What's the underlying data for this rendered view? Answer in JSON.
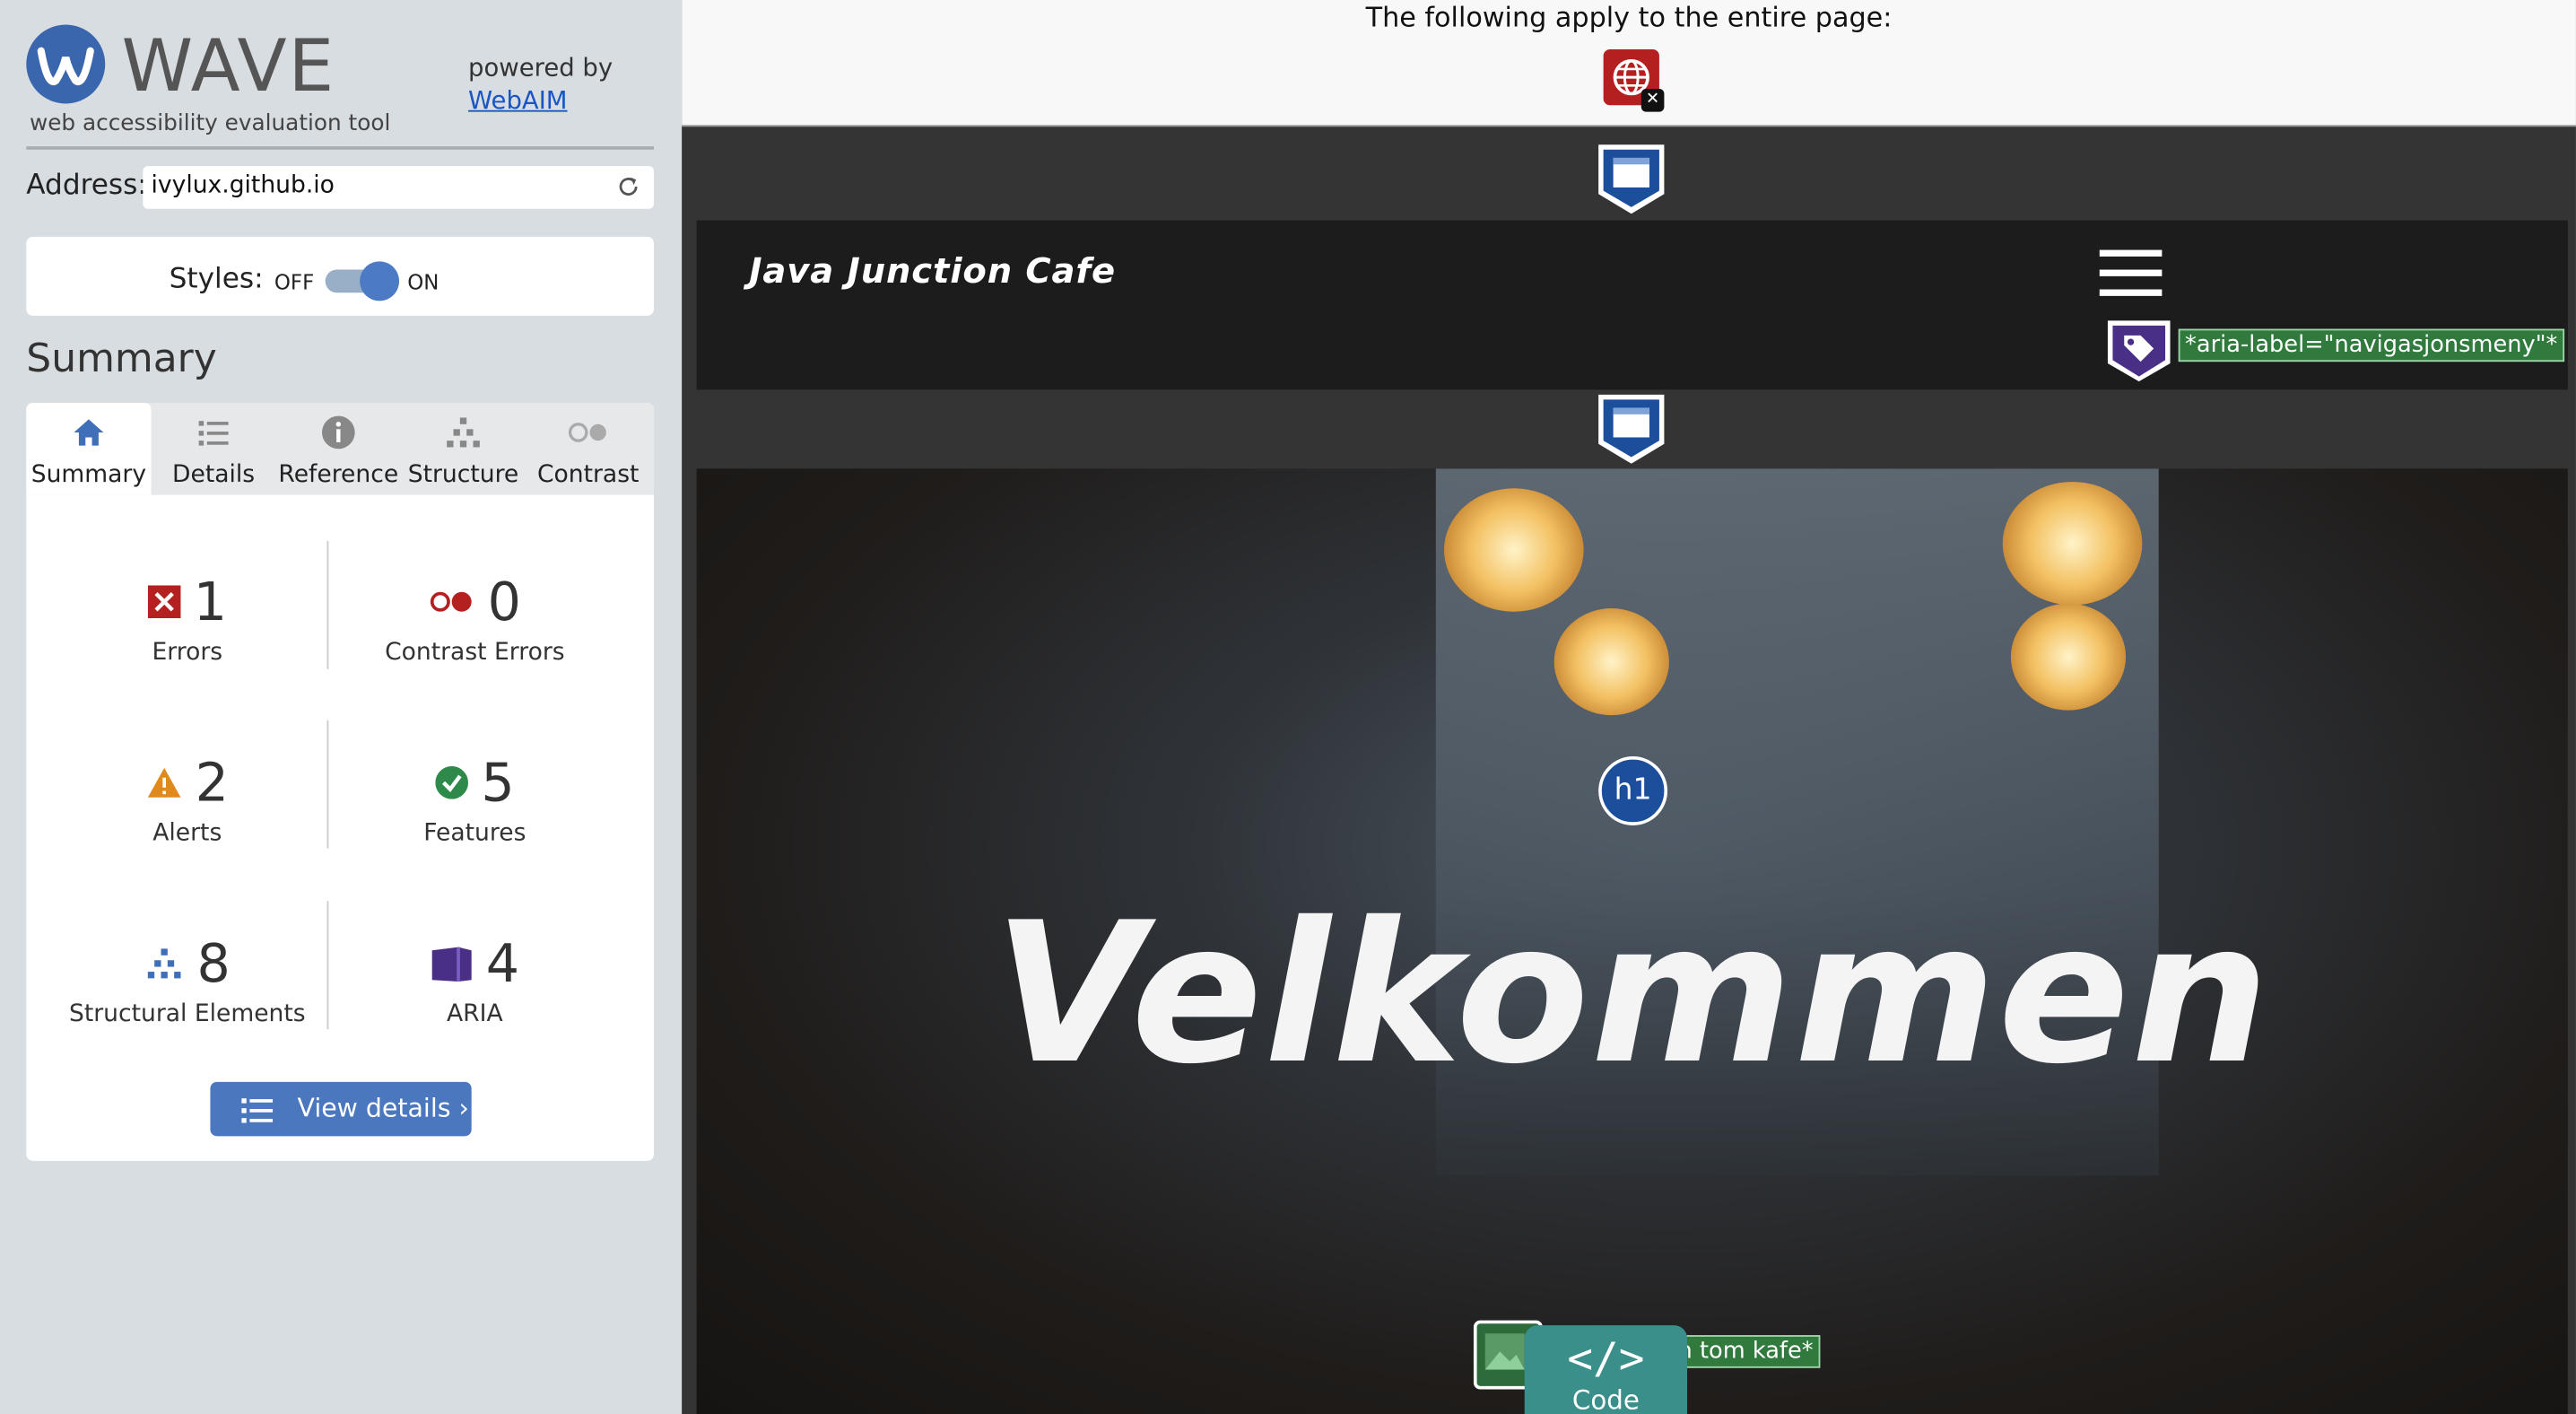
{
  "app": {
    "name": "WAVE",
    "tagline": "web accessibility evaluation tool",
    "powered_by": "powered by",
    "powered_link": "WebAIM"
  },
  "address": {
    "label": "Address:",
    "value": "ivylux.github.io"
  },
  "styles": {
    "label": "Styles:",
    "off": "OFF",
    "on": "ON",
    "state": "ON"
  },
  "summary": {
    "title": "Summary",
    "tabs": [
      {
        "label": "Summary",
        "icon": "home-icon",
        "active": true
      },
      {
        "label": "Details",
        "icon": "list-icon"
      },
      {
        "label": "Reference",
        "icon": "info-icon"
      },
      {
        "label": "Structure",
        "icon": "hierarchy-icon"
      },
      {
        "label": "Contrast",
        "icon": "contrast-icon"
      }
    ],
    "stats": {
      "errors": {
        "count": "1",
        "label": "Errors",
        "icon": "error-icon"
      },
      "contrast": {
        "count": "0",
        "label": "Contrast Errors",
        "icon": "contrast-error-icon"
      },
      "alerts": {
        "count": "2",
        "label": "Alerts",
        "icon": "alert-icon"
      },
      "features": {
        "count": "5",
        "label": "Features",
        "icon": "feature-icon"
      },
      "structural": {
        "count": "8",
        "label": "Structural Elements",
        "icon": "structure-icon"
      },
      "aria": {
        "count": "4",
        "label": "ARIA",
        "icon": "aria-icon"
      }
    },
    "view_details": "View details ›"
  },
  "preview": {
    "apply_text": "The following apply to the entire page:",
    "brand": "Java Junction Cafe",
    "aria_label": "*aria-label=\"navigasjonsmeny\"*",
    "h1_badge": "h1",
    "hero_heading": "Velkommen",
    "image_alt": "*Bilde av en tom kafe*",
    "code_tab": "Code",
    "code_glyph": "</>"
  },
  "colors": {
    "sidebar_bg": "#d8dde2",
    "accent_blue": "#4a77bd",
    "error_red": "#b42020",
    "alert_orange": "#e08a1e",
    "feature_green": "#2e8a4a",
    "aria_purple": "#4a2f86",
    "code_tab_teal": "#3a8f8a"
  }
}
